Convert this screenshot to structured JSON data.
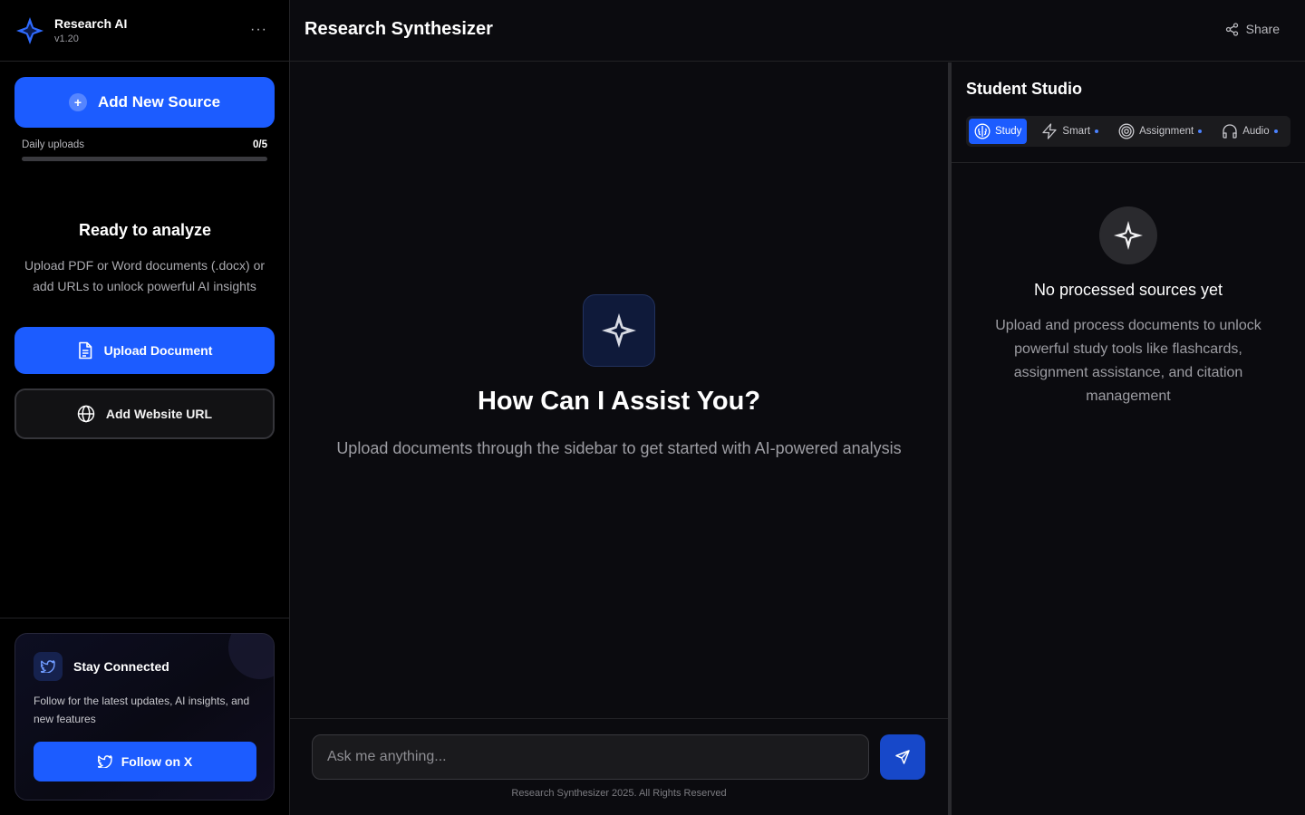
{
  "brand": {
    "name": "Research AI",
    "version": "v1.20",
    "menu_glyph": "···"
  },
  "sidebar": {
    "add_source_label": "Add New Source",
    "daily_uploads_label": "Daily uploads",
    "daily_uploads_count": "0/5",
    "daily_uploads_progress": 0,
    "ready_title": "Ready to analyze",
    "ready_desc": "Upload PDF or Word documents (.docx) or add URLs to unlock powerful AI insights",
    "upload_document_label": "Upload Document",
    "add_url_label": "Add Website URL"
  },
  "connect": {
    "title": "Stay Connected",
    "desc": "Follow for the latest updates, AI insights, and new features",
    "follow_label": "Follow on X"
  },
  "header": {
    "title": "Research Synthesizer",
    "share_label": "Share"
  },
  "main": {
    "hero_title": "How Can I Assist You?",
    "hero_desc": "Upload documents through the sidebar to get started with AI-powered analysis",
    "chat_placeholder": "Ask me anything...",
    "footer_note": "Research Synthesizer 2025. All Rights Reserved"
  },
  "studio": {
    "title": "Student Studio",
    "tabs": [
      {
        "label": "Study",
        "icon": "brain-icon",
        "active": true
      },
      {
        "label": "Smart",
        "icon": "lightning-icon",
        "active": false
      },
      {
        "label": "Assignment",
        "icon": "target-icon",
        "active": false
      },
      {
        "label": "Audio",
        "icon": "headphones-icon",
        "active": false
      }
    ],
    "empty_title": "No processed sources yet",
    "empty_desc": "Upload and process documents to unlock powerful study tools like flashcards, assignment assistance, and citation management"
  },
  "colors": {
    "accent": "#1c5cff",
    "background": "#0b0b0f",
    "sidebar_bg": "#000000"
  }
}
